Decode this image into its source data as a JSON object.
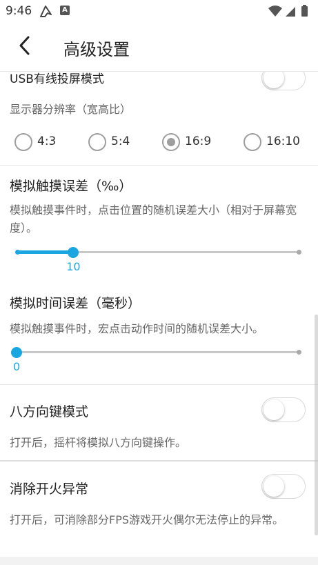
{
  "status_bar": {
    "time": "9:46",
    "app_icon_letter": "A"
  },
  "header": {
    "title": "高级设置"
  },
  "usb": {
    "title": "USB有线投屏模式",
    "enabled": false
  },
  "resolution": {
    "title": "显示器分辨率（宽高比）",
    "options": [
      {
        "label": "4:3",
        "checked": false
      },
      {
        "label": "5:4",
        "checked": false
      },
      {
        "label": "16:9",
        "checked": true
      },
      {
        "label": "16:10",
        "checked": false
      }
    ]
  },
  "touch_error": {
    "title": "模拟触摸误差（‰）",
    "description": "模拟触摸事件时，点击位置的随机误差大小（相对于屏幕宽度）。",
    "value": "10",
    "fraction": 0.2
  },
  "time_error": {
    "title": "模拟时间误差（毫秒）",
    "description": "模拟触摸事件时，宏点击动作时间的随机误差大小。",
    "value": "0",
    "fraction": 0
  },
  "eight_dir": {
    "title": "八方向键模式",
    "description": "打开后，摇杆将模拟八方向键操作。",
    "enabled": false
  },
  "fire_fix": {
    "title": "消除开火异常",
    "description": "打开后，可消除部分FPS游戏开火偶尔无法停止的异常。",
    "enabled": false
  },
  "colors": {
    "accent": "#1aa6e0",
    "toggle_border": "#d9d9d9",
    "radio": "#9e9e9e"
  }
}
